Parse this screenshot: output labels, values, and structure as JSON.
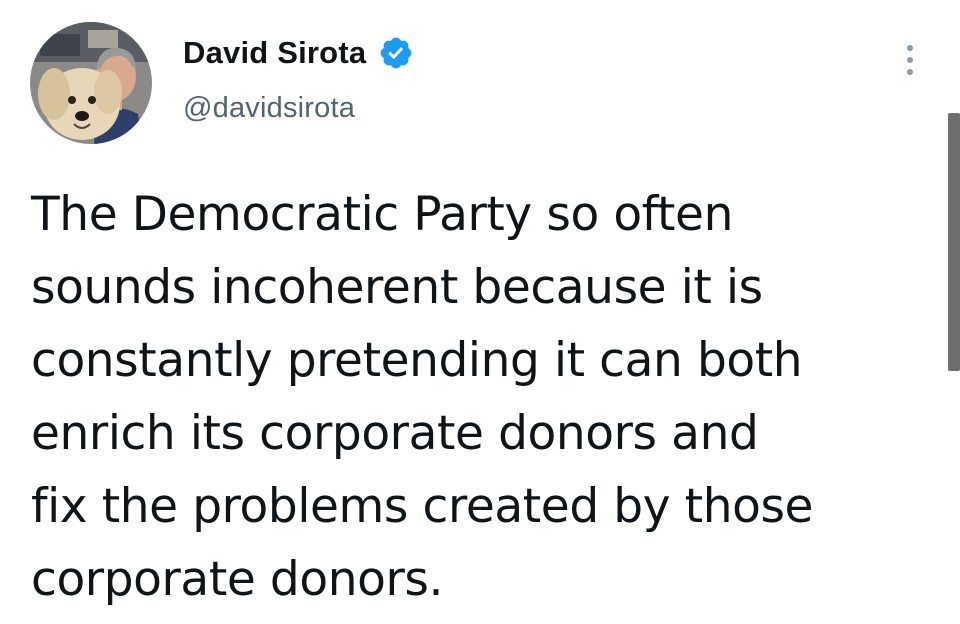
{
  "tweet": {
    "author": {
      "display_name": "David Sirota",
      "handle": "@davidsirota",
      "verified": true
    },
    "text_lines": [
      "The Democratic Party so often",
      "sounds incoherent because it is",
      "constantly pretending it can both",
      "enrich its corporate donors and",
      "fix the problems created by those",
      "corporate donors."
    ]
  },
  "colors": {
    "verified_badge": "#1d9bf0",
    "handle_text": "#536471",
    "body_text": "#0f1419"
  },
  "icons": {
    "verified": "verified-badge-icon",
    "more": "more-options-icon"
  }
}
